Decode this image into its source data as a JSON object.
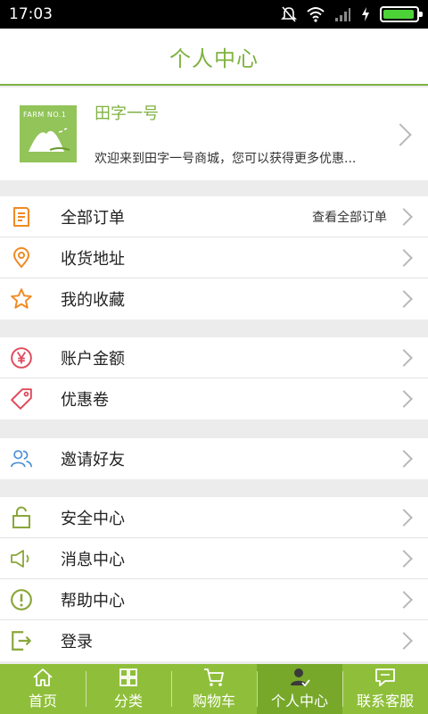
{
  "status": {
    "time": "17:03"
  },
  "header": {
    "title": "个人中心"
  },
  "profile": {
    "name": "田字一号",
    "welcome": "欢迎来到田字一号商城，您可以获得更多优惠...",
    "logo_text": "FARM NO.1"
  },
  "groups": [
    {
      "items": [
        {
          "label": "全部订单",
          "extra": "查看全部订单",
          "icon": "order-list-icon"
        },
        {
          "label": "收货地址",
          "icon": "location-pin-icon"
        },
        {
          "label": "我的收藏",
          "icon": "star-icon"
        }
      ]
    },
    {
      "items": [
        {
          "label": "账户金额",
          "icon": "yen-icon"
        },
        {
          "label": "优惠卷",
          "icon": "tag-icon"
        }
      ]
    },
    {
      "items": [
        {
          "label": "邀请好友",
          "icon": "friends-icon"
        }
      ]
    },
    {
      "items": [
        {
          "label": "安全中心",
          "icon": "lock-icon"
        },
        {
          "label": "消息中心",
          "icon": "speaker-icon"
        },
        {
          "label": "帮助中心",
          "icon": "exclamation-icon"
        },
        {
          "label": "登录",
          "icon": "login-icon"
        }
      ]
    }
  ],
  "nav": [
    {
      "label": "首页",
      "icon": "home-icon"
    },
    {
      "label": "分类",
      "icon": "grid-icon"
    },
    {
      "label": "购物车",
      "icon": "cart-icon"
    },
    {
      "label": "个人中心",
      "icon": "person-icon",
      "active": true
    },
    {
      "label": "联系客服",
      "icon": "chat-icon"
    }
  ],
  "colors": {
    "accent": "#7fb241",
    "nav_bg": "#8fbf3a",
    "nav_active": "#77a82a",
    "orange": "#f08a24",
    "red": "#e0485a",
    "blue": "#4a8fd6",
    "olive": "#8aa63a"
  }
}
